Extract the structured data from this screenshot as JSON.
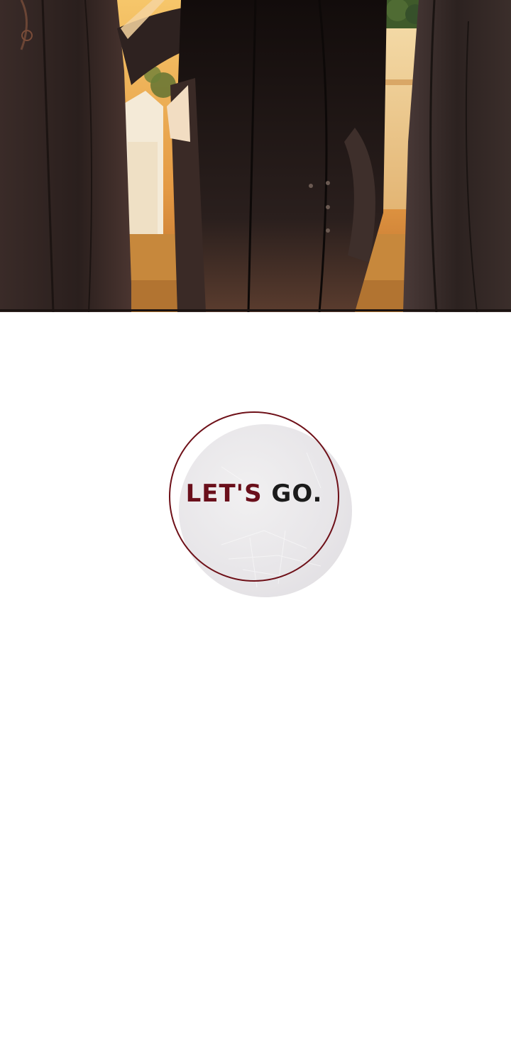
{
  "panel": {
    "scene": "illustration-cropped-figures",
    "colors": {
      "sky_glow": "#f2b552",
      "ground": "#c7883c",
      "cloth_dark": "#2a1f1d",
      "cloth_mid": "#4a3a35",
      "foliage": "#3f5a2a",
      "border": "#1a1210"
    }
  },
  "speech_bubble": {
    "text_part1": "LET'S",
    "text_part2": "GO.",
    "ring_color": "#6e1018",
    "fill_color": "#e7e5e8",
    "text_color": "#1b1b1b",
    "accent_color": "#6a0f1b"
  }
}
